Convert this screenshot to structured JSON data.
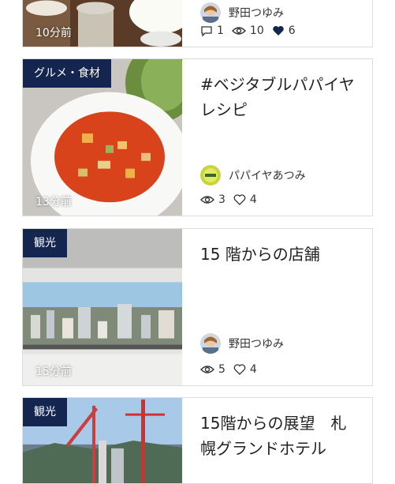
{
  "cards": [
    {
      "time": "10分前",
      "author": "野田つゆみ",
      "comments": "1",
      "views": "10",
      "likes": "6",
      "image": "dessert-photo"
    },
    {
      "category": "グルメ・食材",
      "time": "13分前",
      "title": "#ベジタブルパパイヤレシピ",
      "author": "パパイヤあつみ",
      "views": "3",
      "likes": "4",
      "image": "vegetable-soup-photo"
    },
    {
      "category": "観光",
      "time": "15分前",
      "title": "15 階からの店舗",
      "author": "野田つゆみ",
      "views": "5",
      "likes": "4",
      "image": "city-panorama-photo"
    },
    {
      "category": "観光",
      "title": "15階からの展望　札幌グランドホテル",
      "image": "construction-cranes-photo"
    }
  ]
}
